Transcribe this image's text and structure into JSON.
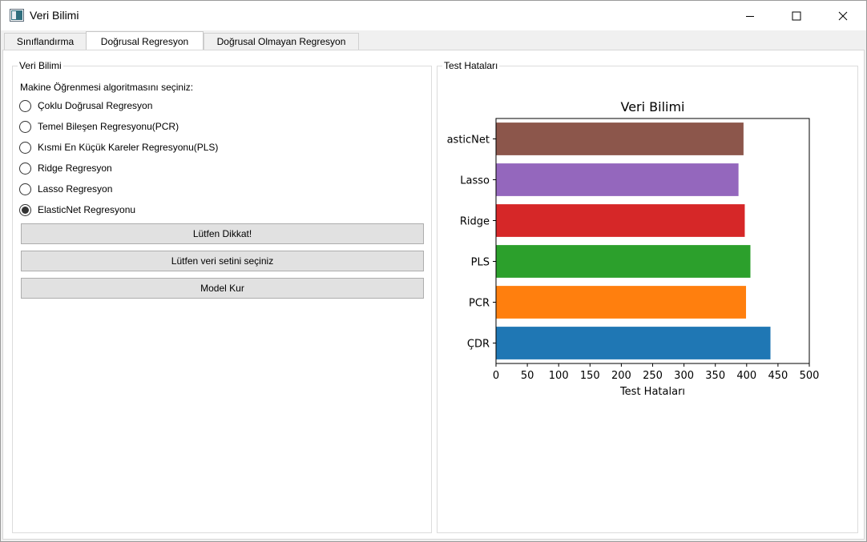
{
  "window": {
    "title": "Veri Bilimi",
    "controls": {
      "minimize": "—",
      "maximize": "☐",
      "close": "✕"
    }
  },
  "tabs": [
    {
      "label": "Sınıflandırma",
      "active": false
    },
    {
      "label": "Doğrusal Regresyon",
      "active": true
    },
    {
      "label": "Doğrusal Olmayan Regresyon",
      "active": false
    }
  ],
  "left_group": {
    "title": "Veri Bilimi",
    "prompt": "Makine Öğrenmesi algoritmasını seçiniz:",
    "options": [
      {
        "label": "Çoklu Doğrusal Regresyon",
        "checked": false
      },
      {
        "label": "Temel Bileşen Regresyonu(PCR)",
        "checked": false
      },
      {
        "label": "Kısmi En Küçük Kareler Regresyonu(PLS)",
        "checked": false
      },
      {
        "label": "Ridge Regresyon",
        "checked": false
      },
      {
        "label": "Lasso Regresyon",
        "checked": false
      },
      {
        "label": "ElasticNet Regresyonu",
        "checked": true
      }
    ],
    "buttons": [
      "Lütfen Dikkat!",
      "Lütfen veri setini seçiniz",
      "Model Kur"
    ]
  },
  "right_group": {
    "title": "Test Hataları"
  },
  "chart_data": {
    "type": "bar",
    "orientation": "horizontal",
    "title": "Veri Bilimi",
    "xlabel": "Test Hataları",
    "ylabel": "",
    "categories": [
      "ÇDR",
      "PCR",
      "PLS",
      "Ridge",
      "Lasso",
      "ElasticNet"
    ],
    "category_tick_labels": [
      "ÇDR",
      "PCR",
      "PLS",
      "Ridge",
      "Lasso",
      "asticNet"
    ],
    "values": [
      438,
      399,
      406,
      397,
      387,
      395
    ],
    "colors": [
      "#1f77b4",
      "#ff7f0e",
      "#2ca02c",
      "#d62728",
      "#9467bd",
      "#8c564b"
    ],
    "xlim": [
      0,
      500
    ],
    "xticks": [
      0,
      50,
      100,
      150,
      200,
      250,
      300,
      350,
      400,
      450,
      500
    ],
    "grid": false,
    "legend": "none"
  }
}
